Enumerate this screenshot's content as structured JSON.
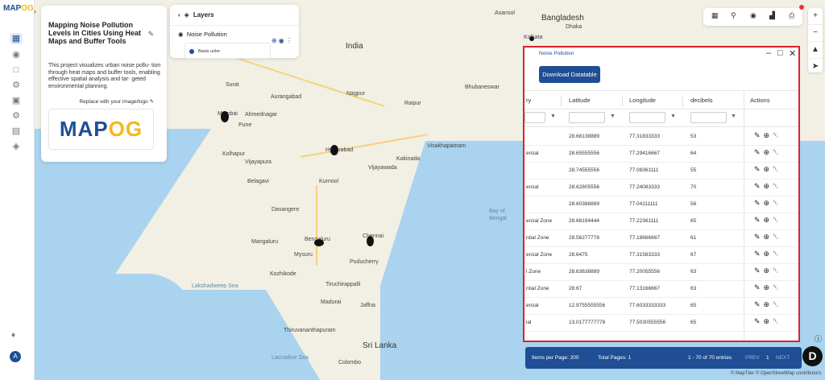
{
  "app": {
    "logo_text": "MAP",
    "logo_accent": "OG"
  },
  "sidebar": {
    "icons": [
      "map-icon",
      "marker-icon",
      "file-icon",
      "settings-icon",
      "image-icon",
      "gear-icon",
      "chat-icon",
      "layers-icon"
    ],
    "active_index": 0,
    "avatar_letter": "A"
  },
  "info_panel": {
    "title": "Mapping Noise Pollution Levels in Cities Using Heat Maps and Buffer Tools",
    "description": "This project visualizes urban noise pollu- tion through heat maps and buffer tools, enabling effective spatial analysis and tar- geted environmental planning.",
    "replace_label": "Replace with your image/logo",
    "logo_text": "MAP",
    "logo_accent": "OG"
  },
  "layers_panel": {
    "title": "Layers",
    "layer_name": "Noise Pollution",
    "legend_label": "Basis uoler"
  },
  "map": {
    "labels": [
      {
        "text": "Bangladesh",
        "cls": "big"
      },
      {
        "text": "India",
        "cls": "big"
      },
      {
        "text": "Asansol",
        "cls": ""
      },
      {
        "text": "Dhaka",
        "cls": ""
      },
      {
        "text": "Kolkata",
        "cls": ""
      },
      {
        "text": "Bhubaneswar",
        "cls": ""
      },
      {
        "text": "Surat",
        "cls": ""
      },
      {
        "text": "Mumbai",
        "cls": ""
      },
      {
        "text": "Pune",
        "cls": ""
      },
      {
        "text": "Ahmednagar",
        "cls": ""
      },
      {
        "text": "Aurangabad",
        "cls": ""
      },
      {
        "text": "Nagpur",
        "cls": ""
      },
      {
        "text": "Raipur",
        "cls": ""
      },
      {
        "text": "Hyderabad",
        "cls": ""
      },
      {
        "text": "Kolhapur",
        "cls": ""
      },
      {
        "text": "Vijayapura",
        "cls": ""
      },
      {
        "text": "Belagavi",
        "cls": ""
      },
      {
        "text": "Kurnool",
        "cls": ""
      },
      {
        "text": "Vijayawada",
        "cls": ""
      },
      {
        "text": "Visakhapatnam",
        "cls": ""
      },
      {
        "text": "Kakinada",
        "cls": ""
      },
      {
        "text": "Davangere",
        "cls": ""
      },
      {
        "text": "Bengaluru",
        "cls": ""
      },
      {
        "text": "Chennai",
        "cls": ""
      },
      {
        "text": "Mangaluru",
        "cls": ""
      },
      {
        "text": "Mysuru",
        "cls": ""
      },
      {
        "text": "Puducherry",
        "cls": ""
      },
      {
        "text": "Kozhikode",
        "cls": ""
      },
      {
        "text": "Tiruchirappalli",
        "cls": ""
      },
      {
        "text": "Madurai",
        "cls": ""
      },
      {
        "text": "Jaffna",
        "cls": ""
      },
      {
        "text": "Thiruvananthapuram",
        "cls": ""
      },
      {
        "text": "Sri Lanka",
        "cls": "big"
      },
      {
        "text": "Colombo",
        "cls": ""
      },
      {
        "text": "Bay of Bengal",
        "cls": "sea-label"
      },
      {
        "text": "Lakshadweep Sea",
        "cls": "sea-label"
      },
      {
        "text": "Laccadive Sea",
        "cls": "sea-label"
      }
    ]
  },
  "table_window": {
    "title": "Noise Pollution",
    "download_label": "Download Datatable",
    "columns": [
      "ry",
      "Latitude",
      "Longitude",
      "decibels",
      "Actions"
    ],
    "rows": [
      {
        "cat": "",
        "lat": "28.68138889",
        "lon": "77.31833333",
        "db": "53"
      },
      {
        "cat": "ercial",
        "lat": "28.65555556",
        "lon": "77.29416667",
        "db": "64"
      },
      {
        "cat": "",
        "lat": "28.74555556",
        "lon": "77.08361111",
        "db": "55"
      },
      {
        "cat": "ercial",
        "lat": "28.62805556",
        "lon": "77.24083333",
        "db": "70"
      },
      {
        "cat": "",
        "lat": "28.60388889",
        "lon": "77.04111111",
        "db": "56"
      },
      {
        "cat": "ercial Zone",
        "lat": "28.68194444",
        "lon": "77.22361111",
        "db": "65"
      },
      {
        "cat": "ntial Zone",
        "lat": "28.56277778",
        "lon": "77.18666667",
        "db": "61"
      },
      {
        "cat": "ercial Zone",
        "lat": "28.6475",
        "lon": "77.31583333",
        "db": "67"
      },
      {
        "cat": "l Zone",
        "lat": "28.63638889",
        "lon": "77.20055556",
        "db": "63"
      },
      {
        "cat": "ntial Zone",
        "lat": "28.67",
        "lon": "77.13166667",
        "db": "63"
      },
      {
        "cat": "ercial",
        "lat": "12.9755555556",
        "lon": "77.6033333333",
        "db": "65"
      },
      {
        "cat": "ial",
        "lat": "13.0177777778",
        "lon": "77.5030555556",
        "db": "65"
      }
    ]
  },
  "pager": {
    "items_per_page": "Items per Page: 200",
    "total_pages": "Total Pages: 1",
    "entries": "1 - 70 of 70 entries",
    "prev": "PREV",
    "page": "1",
    "next": "NEXT"
  },
  "attribution": "© MapTiler © OpenStreetMap contributors",
  "colors": {
    "brand": "#1f4e94",
    "accent": "#f2b81d",
    "highlight": "#d9232d"
  }
}
